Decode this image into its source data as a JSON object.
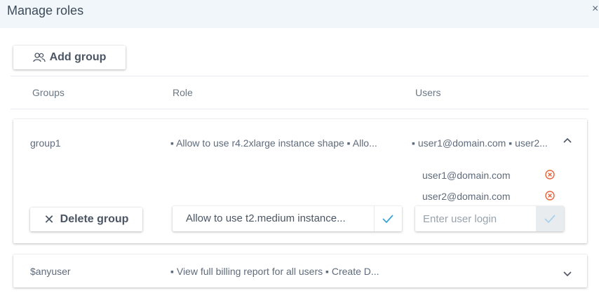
{
  "dialog": {
    "title": "Manage roles",
    "close_glyph": "×"
  },
  "toolbar": {
    "add_group_label": "Add group",
    "add_group_icon": "users-icon"
  },
  "columns": {
    "groups": "Groups",
    "role": "Role",
    "users": "Users"
  },
  "groups": [
    {
      "name": "group1",
      "roles_summary": "▪ Allow to use r4.2xlarge instance shape ▪ Allo...",
      "users_summary": "▪ user1@domain.com ▪ user2...",
      "expanded": true,
      "users": [
        "user1@domain.com",
        "user2@domain.com"
      ],
      "delete_label": "Delete group",
      "role_select_value": "Allow to use t2.medium instance...",
      "user_input_placeholder": "Enter user login"
    },
    {
      "name": "$anyuser",
      "roles_summary": "▪ View full billing report for all users ▪ Create D...",
      "users_summary": "",
      "expanded": false
    }
  ],
  "colors": {
    "accent": "#3ea3d6",
    "remove": "#e8623a",
    "header_bg": "#f1f6fa"
  }
}
